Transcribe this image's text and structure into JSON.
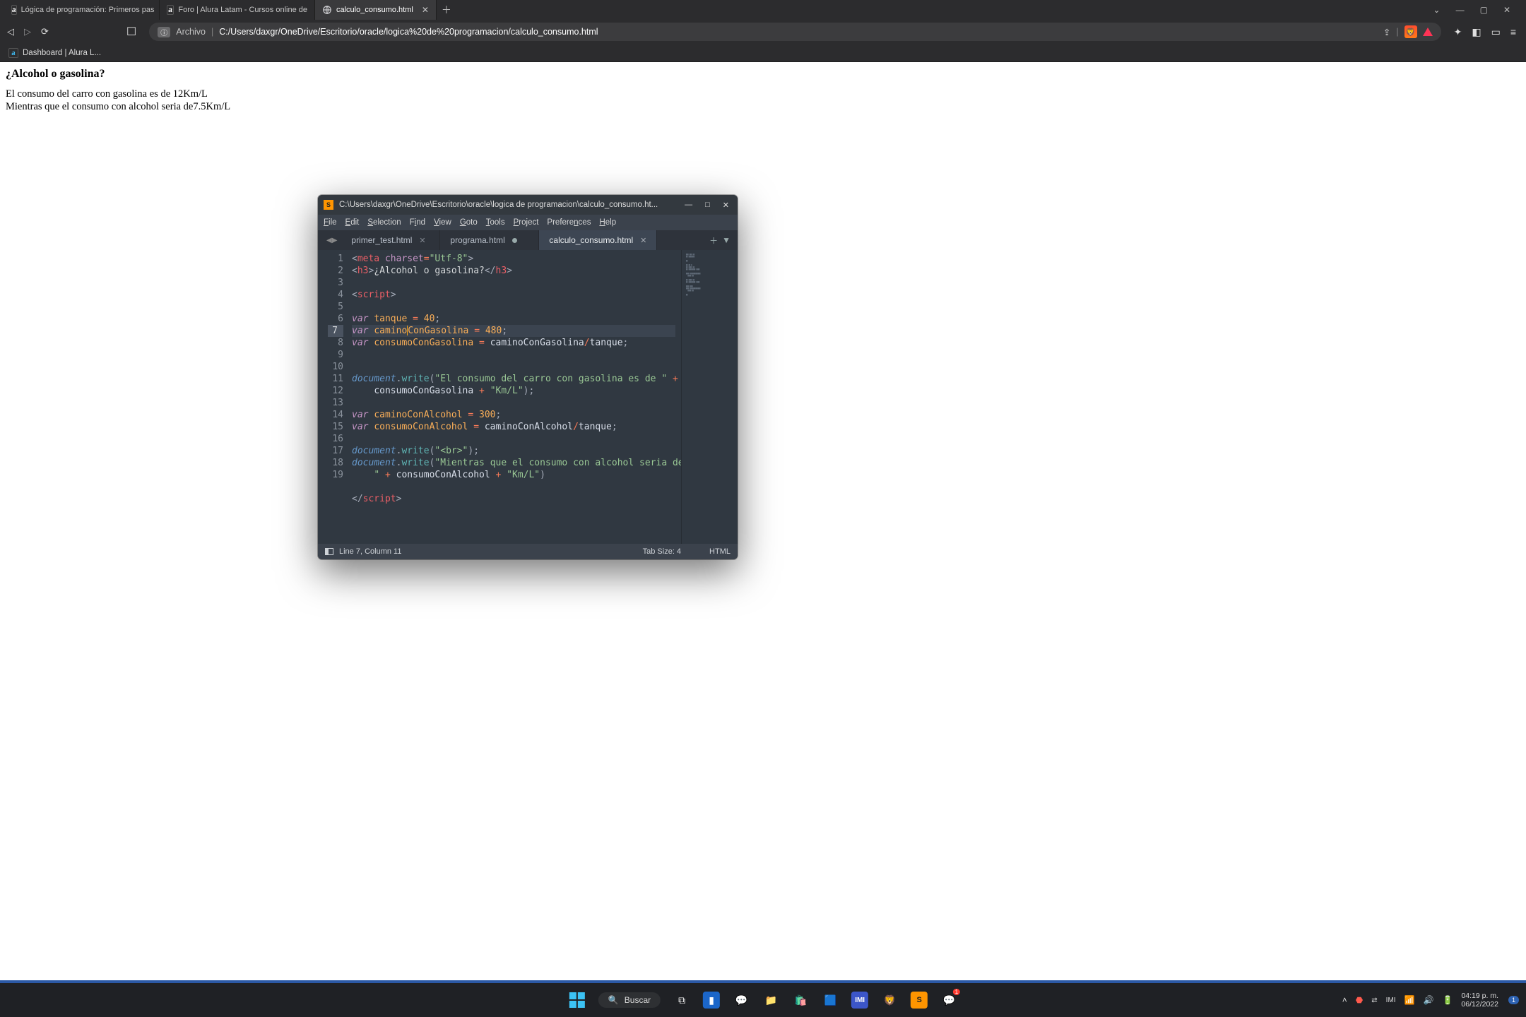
{
  "browser": {
    "tabs": [
      {
        "favicon": "a",
        "label": "Lógica de programación: Primeros pas"
      },
      {
        "favicon": "a",
        "label": "Foro | Alura Latam - Cursos online de"
      },
      {
        "favicon": "globe",
        "label": "calculo_consumo.html",
        "active": true
      }
    ],
    "address": {
      "prefix": "Archivo",
      "url": "C:/Users/daxgr/OneDrive/Escritorio/oracle/logica%20de%20programacion/calculo_consumo.html"
    },
    "bookmark": {
      "favicon": "a",
      "label": "Dashboard | Alura L..."
    }
  },
  "page": {
    "heading": "¿Alcohol o gasolina?",
    "line1": "El consumo del carro con gasolina es de 12Km/L",
    "line2": "Mientras que el consumo con alcohol seria de7.5Km/L"
  },
  "editor": {
    "title": "C:\\Users\\daxgr\\OneDrive\\Escritorio\\oracle\\logica de programacion\\calculo_consumo.ht...",
    "menu": [
      "File",
      "Edit",
      "Selection",
      "Find",
      "View",
      "Goto",
      "Tools",
      "Project",
      "Preferences",
      "Help"
    ],
    "tabs": [
      {
        "name": "primer_test.html",
        "state": "clean"
      },
      {
        "name": "programa.html",
        "state": "dirty"
      },
      {
        "name": "calculo_consumo.html",
        "state": "clean",
        "active": true
      }
    ],
    "status": {
      "left": "Line 7, Column 11",
      "tab": "Tab Size: 4",
      "lang": "HTML"
    },
    "code": {
      "active_line": 7,
      "lines": [
        1,
        2,
        3,
        4,
        5,
        6,
        7,
        8,
        9,
        10,
        11,
        12,
        13,
        14,
        15,
        16,
        17,
        18,
        19
      ]
    }
  },
  "taskbar": {
    "search": "Buscar",
    "time": "04:19 p. m.",
    "date": "06/12/2022",
    "notif_count": "1"
  }
}
